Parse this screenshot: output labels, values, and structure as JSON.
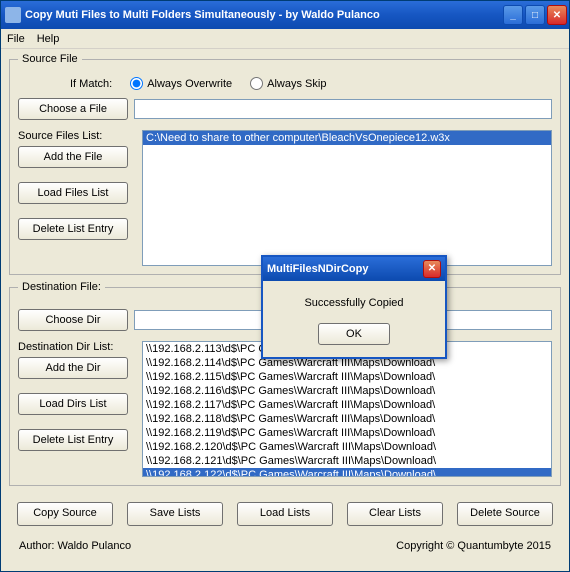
{
  "window": {
    "title": "Copy Muti Files to Multi Folders Simultaneously - by Waldo Pulanco"
  },
  "menu": {
    "file": "File",
    "help": "Help"
  },
  "source": {
    "legend": "Source File",
    "ifmatch": "If Match:",
    "overwrite": "Always Overwrite",
    "skip": "Always Skip",
    "choosefile": "Choose a File",
    "filevalue": "",
    "listlabel": "Source Files List:",
    "items": [
      "C:\\Need to share to other computer\\BleachVsOnepiece12.w3x"
    ],
    "addfile": "Add the File",
    "loadlist": "Load Files List",
    "delentry": "Delete List Entry"
  },
  "dest": {
    "legend": "Destination File:",
    "choosedir": "Choose Dir",
    "dirvalue": "",
    "listlabel": "Destination Dir List:",
    "items": [
      "\\\\192.168.2.113\\d$\\PC Games\\Warcraft III\\Maps\\Download\\",
      "\\\\192.168.2.114\\d$\\PC Games\\Warcraft III\\Maps\\Download\\",
      "\\\\192.168.2.115\\d$\\PC Games\\Warcraft III\\Maps\\Download\\",
      "\\\\192.168.2.116\\d$\\PC Games\\Warcraft III\\Maps\\Download\\",
      "\\\\192.168.2.117\\d$\\PC Games\\Warcraft III\\Maps\\Download\\",
      "\\\\192.168.2.118\\d$\\PC Games\\Warcraft III\\Maps\\Download\\",
      "\\\\192.168.2.119\\d$\\PC Games\\Warcraft III\\Maps\\Download\\",
      "\\\\192.168.2.120\\d$\\PC Games\\Warcraft III\\Maps\\Download\\",
      "\\\\192.168.2.121\\d$\\PC Games\\Warcraft III\\Maps\\Download\\",
      "\\\\192.168.2.122\\d$\\PC Games\\Warcraft III\\Maps\\Download\\"
    ],
    "adddir": "Add the Dir",
    "loadlist": "Load Dirs List",
    "delentry": "Delete List Entry"
  },
  "bottom": {
    "copy": "Copy Source",
    "save": "Save Lists",
    "load": "Load Lists",
    "clear": "Clear Lists",
    "delsrc": "Delete Source"
  },
  "footer": {
    "author": "Author: Waldo Pulanco",
    "copyright": "Copyright © Quantumbyte 2015"
  },
  "dialog": {
    "title": "MultiFilesNDirCopy",
    "msg": "Successfully Copied",
    "ok": "OK"
  }
}
